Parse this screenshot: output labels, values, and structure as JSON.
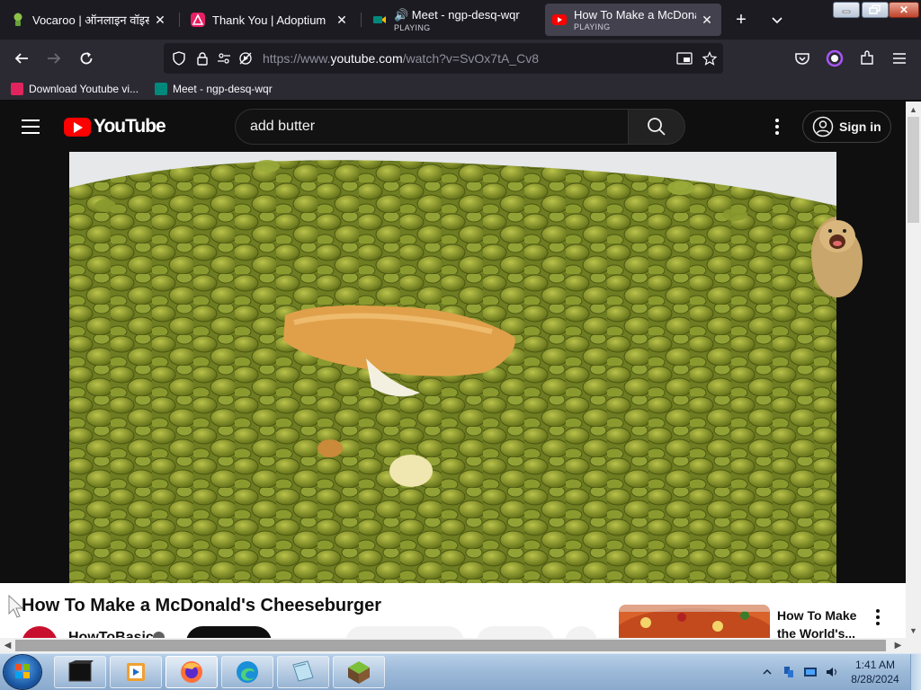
{
  "browser": {
    "tabs": [
      {
        "title": "Vocaroo | ऑनलाइन वॉइस रि",
        "sub": "",
        "active": false
      },
      {
        "title": "Thank You | Adoptium",
        "sub": "",
        "active": false
      },
      {
        "title": "🔊 Meet - ngp-desq-wqr",
        "sub": "PLAYING",
        "active": false
      },
      {
        "title": "How To Make a McDonald",
        "sub": "PLAYING",
        "active": true
      }
    ],
    "new_tab_icon": "plus-icon",
    "tab_list_icon": "chevron-down-icon",
    "url": {
      "prefix": "https://www.",
      "domain": "youtube.com",
      "path": "/watch?v=SvOx7tA_Cv8"
    },
    "bookmarks": [
      {
        "label": "Download Youtube vi...",
        "color": "#e0245e"
      },
      {
        "label": "Meet - ngp-desq-wqr",
        "color": "#00897b"
      }
    ]
  },
  "youtube": {
    "logo_text": "YouTube",
    "search_value": "add butter",
    "signin_label": "Sign in",
    "video_title": "How To Make a McDonald's Cheeseburger",
    "channel_name": "HowToBasic",
    "recommendation_title": "How To Make the World's...",
    "brand_color": "#ff0000"
  },
  "taskbar": {
    "time": "1:41 AM",
    "date": "8/28/2024",
    "pinned": [
      "terminal-icon",
      "media-player-icon",
      "firefox-icon",
      "edge-icon",
      "notebook-icon",
      "minecraft-icon"
    ]
  }
}
